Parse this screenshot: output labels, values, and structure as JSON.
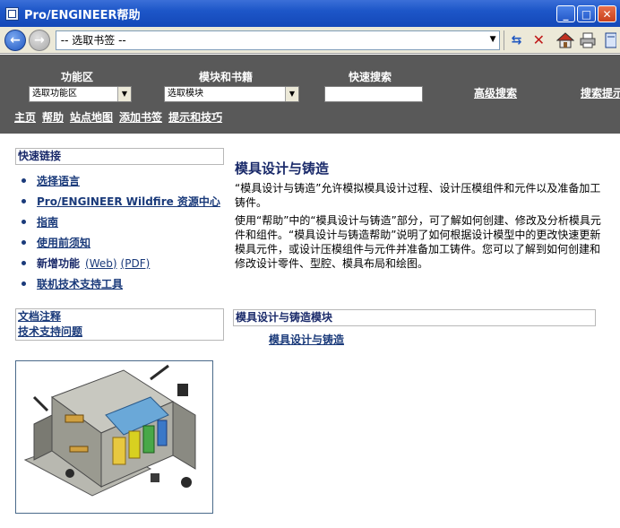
{
  "window": {
    "title": "Pro/ENGINEER帮助",
    "controls": [
      "minimize-icon",
      "maximize-icon",
      "close-icon"
    ]
  },
  "navbar": {
    "address_value": "-- 选取书签 --",
    "icons": [
      "back-icon",
      "forward-icon",
      "refresh-icon",
      "stop-icon",
      "home-icon",
      "print-icon",
      "bookmark-icon"
    ]
  },
  "header": {
    "func_area_label": "功能区",
    "func_area_select": "选取功能区",
    "module_label": "模块和书籍",
    "module_select": "选取模块",
    "quick_search_label": "快速搜索",
    "quick_search_value": "",
    "advanced_search": "高级搜索",
    "search_tips": "搜索提示",
    "nav": [
      "主页",
      "帮助",
      "站点地图",
      "添加书签",
      "提示和技巧"
    ]
  },
  "sidebar": {
    "quick_links_title": "快速链接",
    "links": [
      {
        "label": "选择语言"
      },
      {
        "label": "Pro/ENGINEER Wildfire 资源中心"
      },
      {
        "label": "指南"
      },
      {
        "label": "使用前须知"
      }
    ],
    "new_feature_label": "新增功能",
    "new_feature_web": "(Web)",
    "new_feature_pdf": "(PDF)",
    "support_tools": "联机技术支持工具",
    "doc_links": [
      "文档注释",
      "技术支持问题"
    ]
  },
  "main": {
    "title": "模具设计与铸造",
    "para1": "“模具设计与铸造”允许模拟模具设计过程、设计压模组件和元件以及准备加工铸件。",
    "para2": "使用“帮助”中的“模具设计与铸造”部分，可了解如何创建、修改及分析模具元件和组件。“模具设计与铸造帮助”说明了如何根据设计模型中的更改快速更新模具元件，或设计压模组件与元件并准备加工铸件。您可以了解到如何创建和修改设计零件、型腔、模具布局和绘图。",
    "section_title": "模具设计与铸造模块",
    "section_link": "模具设计与铸造"
  },
  "colors": {
    "titlebar": "#1d56c8",
    "header_band": "#595959",
    "link": "#1a3a7a",
    "heading": "#1a2a6a"
  }
}
